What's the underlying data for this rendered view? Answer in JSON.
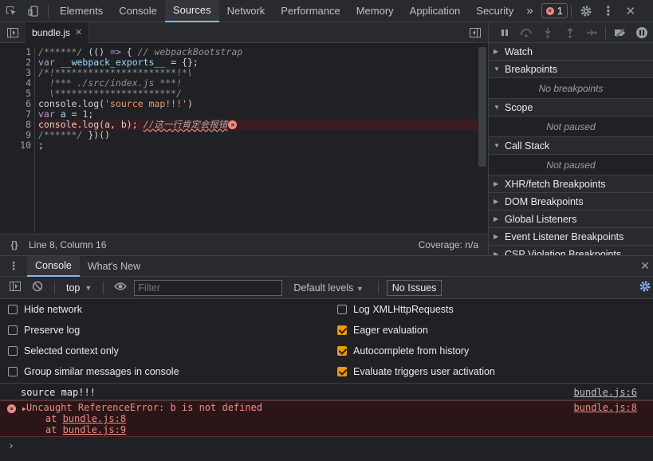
{
  "toolbar": {
    "tabs": [
      "Elements",
      "Console",
      "Sources",
      "Network",
      "Performance",
      "Memory",
      "Application",
      "Security"
    ],
    "active_tab": "Sources",
    "more_label": "»",
    "error_count": "1"
  },
  "editor": {
    "file_tab": "bundle.js",
    "line_numbers": [
      "1",
      "2",
      "3",
      "4",
      "5",
      "6",
      "7",
      "8",
      "9",
      "10"
    ],
    "status_position": "Line 8, Column 16",
    "coverage": "Coverage: n/a",
    "braces_label": "{}"
  },
  "debugger": {
    "sections": {
      "watch": "Watch",
      "breakpoints": "Breakpoints",
      "breakpoints_empty": "No breakpoints",
      "scope": "Scope",
      "scope_state": "Not paused",
      "call_stack": "Call Stack",
      "call_stack_state": "Not paused",
      "xhr": "XHR/fetch Breakpoints",
      "dom": "DOM Breakpoints",
      "global": "Global Listeners",
      "event": "Event Listener Breakpoints",
      "csp": "CSP Violation Breakpoints"
    }
  },
  "drawer": {
    "tabs": [
      "Console",
      "What's New"
    ],
    "active_tab": "Console"
  },
  "console": {
    "context": "top",
    "filter_placeholder": "Filter",
    "levels": "Default levels",
    "issues": "No Issues",
    "settings_left": [
      "Hide network",
      "Preserve log",
      "Selected context only",
      "Group similar messages in console"
    ],
    "settings_right": [
      "Log XMLHttpRequests",
      "Eager evaluation",
      "Autocomplete from history",
      "Evaluate triggers user activation"
    ],
    "settings_right_checked": [
      false,
      true,
      true,
      true
    ],
    "log_message": "source map!!!",
    "log_source": "bundle.js:6",
    "error_message": "Uncaught ReferenceError: b is not defined",
    "error_source": "bundle.js:8",
    "stack": [
      {
        "prefix": "    at ",
        "link": "bundle.js:8"
      },
      {
        "prefix": "    at ",
        "link": "bundle.js:9"
      }
    ],
    "prompt": "›"
  },
  "colors": {
    "accent": "#8ab4f8",
    "error": "#f28b82",
    "checkbox_on": "#f29900"
  }
}
